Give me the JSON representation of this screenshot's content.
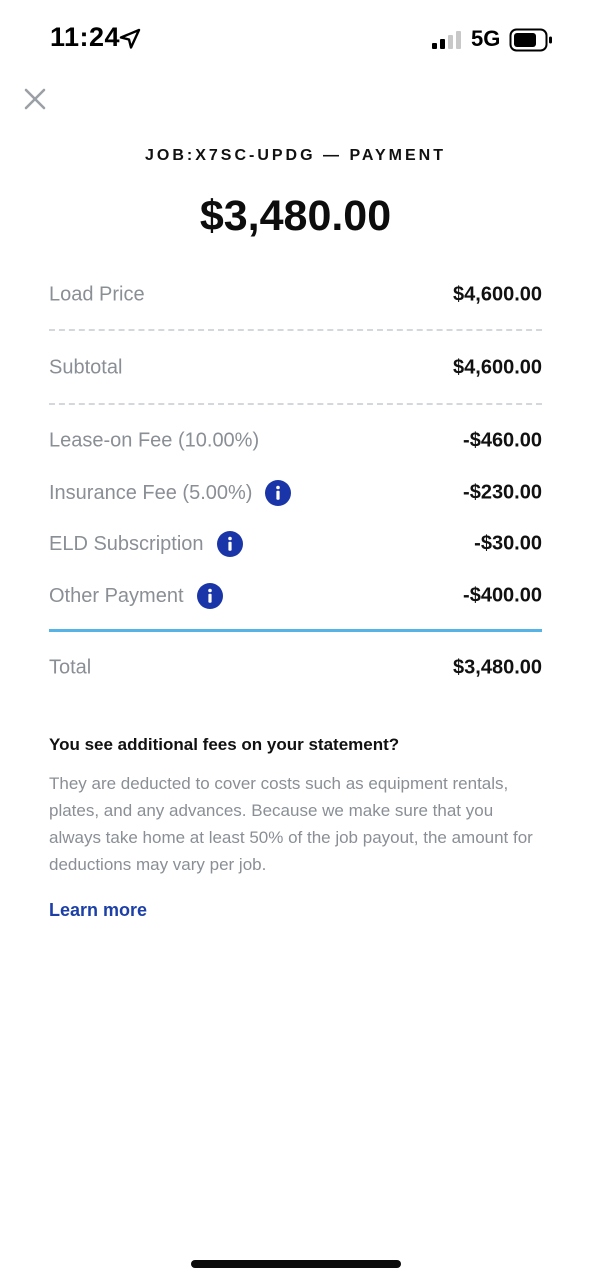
{
  "status_bar": {
    "time": "11:24",
    "network": "5G",
    "icons": [
      "location-arrow-icon",
      "signal-bars-icon",
      "battery-icon"
    ]
  },
  "header": {
    "job_title": "JOB:X7SC-UPDG — PAYMENT",
    "total_amount": "$3,480.00"
  },
  "breakdown": {
    "load_price": {
      "label": "Load Price",
      "value": "$4,600.00"
    },
    "subtotal": {
      "label": "Subtotal",
      "value": "$4,600.00"
    },
    "fees": [
      {
        "label": "Lease-on Fee (10.00%)",
        "value": "-$460.00",
        "has_info": false
      },
      {
        "label": "Insurance Fee (5.00%)",
        "value": "-$230.00",
        "has_info": true
      },
      {
        "label": "ELD Subscription",
        "value": "-$30.00",
        "has_info": true
      },
      {
        "label": "Other Payment",
        "value": "-$400.00",
        "has_info": true
      }
    ],
    "total": {
      "label": "Total",
      "value": "$3,480.00"
    }
  },
  "info": {
    "heading": "You see additional fees on your statement?",
    "body": "They are deducted to cover costs such as equipment rentals, plates, and any advances. Because we make sure that you always take home at least 50% of the job payout, the amount for deductions may vary per job.",
    "link_label": "Learn more"
  },
  "colors": {
    "accent_blue": "#1a35a8",
    "divider_blue": "#56b3e6",
    "label_gray": "#8a8f96",
    "link_blue": "#1c3fa8"
  }
}
